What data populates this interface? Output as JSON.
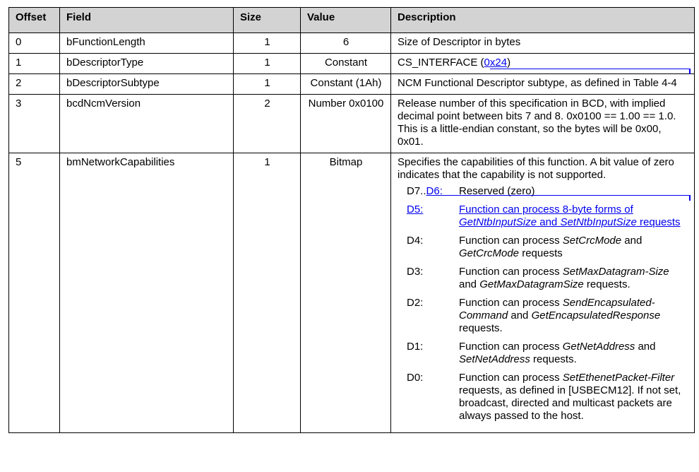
{
  "header": {
    "offset": "Offset",
    "field": "Field",
    "size": "Size",
    "value": "Value",
    "description": "Description"
  },
  "rows": [
    {
      "offset": "0",
      "field": "bFunctionLength",
      "size": "1",
      "value": "6",
      "description": "Size of Descriptor in bytes"
    },
    {
      "offset": "1",
      "field": "bDescriptorType",
      "size": "1",
      "value": "Constant",
      "description_prefix": "CS_INTERFACE (",
      "description_link": "0x24",
      "description_suffix": ")"
    },
    {
      "offset": "2",
      "field": "bDescriptorSubtype",
      "size": "1",
      "value": "Constant (1Ah)",
      "description": "NCM Functional Descriptor subtype, as defined in Table 4-4"
    },
    {
      "offset": "3",
      "field": "bcdNcmVersion",
      "size": "2",
      "value": "Number 0x0100",
      "description": "Release number of this specification in BCD, with implied decimal point between bits 7 and 8. 0x0100 == 1.00 == 1.0.  This is a little-endian constant, so the bytes will be 0x00, 0x01."
    },
    {
      "offset": "5",
      "field": "bmNetworkCapabilities",
      "size": "1",
      "value": "Bitmap",
      "description": "Specifies the capabilities of this function.  A bit value of zero indicates that the capability is not supported."
    }
  ],
  "bits": {
    "d7d6_prefix": "D7..",
    "d7d6_link": "D6:",
    "d7d6_text": "Reserved (zero)",
    "d5_key": "D5:",
    "d5_text_a": "Function can process 8-byte forms of ",
    "d5_text_b": "GetNtbInputSize",
    "d5_text_c": " and ",
    "d5_text_d": "SetNtbInputSize",
    "d5_text_e": " requests",
    "d4_key": "D4:",
    "d4_a": "Function can process ",
    "d4_b": "SetCrcMode",
    "d4_c": " and ",
    "d4_d": "GetCrcMode",
    "d4_e": " requests",
    "d3_key": "D3:",
    "d3_a": "Function can process ",
    "d3_b": "SetMaxDatagram-Size",
    "d3_c": " and ",
    "d3_d": "GetMaxDatagramSize",
    "d3_e": " requests.",
    "d2_key": "D2:",
    "d2_a": "Function can process ",
    "d2_b": "SendEncapsulated-Command",
    "d2_c": " and ",
    "d2_d": "GetEncapsulatedResponse",
    "d2_e": " requests.",
    "d1_key": "D1:",
    "d1_a": "Function can process ",
    "d1_b": "GetNetAddress",
    "d1_c": " and ",
    "d1_d": "SetNetAddress",
    "d1_e": " requests.",
    "d0_key": "D0:",
    "d0_a": "Function can process ",
    "d0_b": "SetEthenetPacket-Filter",
    "d0_c": " requests, as defined in [USBECM12]. If not set, broadcast, directed and multicast packets are always passed to the host."
  },
  "colors": {
    "link": "#0000ee",
    "header_bg": "#d3d3d3"
  }
}
